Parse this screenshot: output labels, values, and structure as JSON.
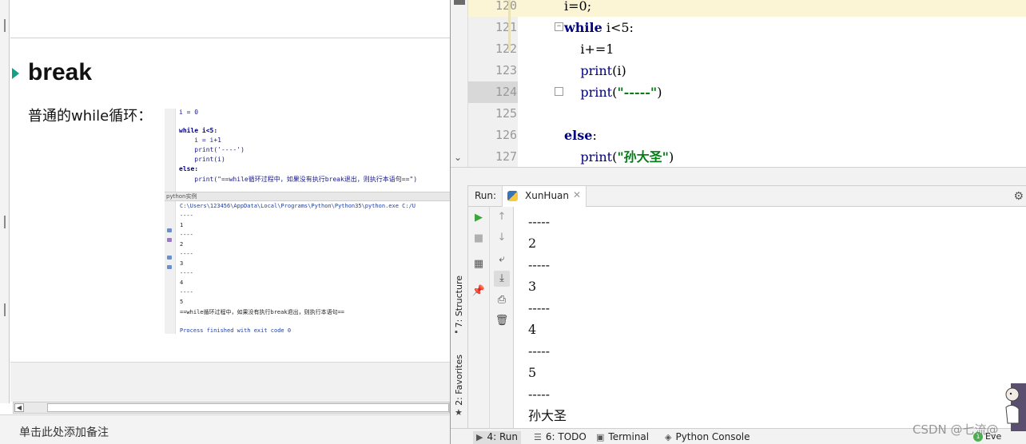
{
  "slide": {
    "heading": "break",
    "lead_text": "普通的while循环：",
    "screenshot": {
      "code_lines": [
        "i = 0",
        "",
        "while i<5:",
        "    i = i+1",
        "    print('----')",
        "    print(i)",
        "else:",
        "    print(\"==while循环过程中，如果没有执行break退出，则执行本语句==\")"
      ],
      "panel_title": "python实例",
      "output_lines": [
        "C:\\Users\\123456\\AppData\\Local\\Programs\\Python\\Python35\\python.exe C:/U",
        "----",
        "1",
        "----",
        "2",
        "----",
        "3",
        "----",
        "4",
        "----",
        "5",
        "==while循环过程中，如果没有执行break退出，则执行本语句==",
        "",
        "Process finished with exit code 0"
      ]
    },
    "notes_placeholder": "单击此处添加备注"
  },
  "ide": {
    "line_numbers": [
      "120",
      "121",
      "122",
      "123",
      "124",
      "125",
      "126",
      "127"
    ],
    "code": {
      "l120": "i=0;",
      "l121_kw": "while",
      "l121_rest": " i<5:",
      "l122": "    i+=1",
      "l123_fn": "    print",
      "l123_rest": "(i)",
      "l124_fn": "    print",
      "l124_open": "(",
      "l124_str": "\"-----\"",
      "l124_close": ")",
      "l126_kw": "else",
      "l126_rest": ":",
      "l127_fn": "    print",
      "l127_open": "(",
      "l127_str": "\"孙大圣\"",
      "l127_close": ")"
    },
    "run": {
      "label": "Run:",
      "tab_name": "XunHuan",
      "console_lines": [
        "-----",
        "2",
        "-----",
        "3",
        "-----",
        "4",
        "-----",
        "5",
        "-----",
        "孙大圣"
      ]
    },
    "side_tabs": {
      "structure": "7: Structure",
      "favorites": "2: Favorites"
    },
    "status_bar": {
      "run": "4: Run",
      "todo": "6: TODO",
      "terminal": "Terminal",
      "python_console": "Python Console",
      "event_log": "Eve"
    },
    "icons": {
      "run": "play-icon",
      "stop": "stop-icon",
      "settings": "gear-icon"
    },
    "colors": {
      "keyword": "#000080",
      "string": "#067d17",
      "current_line": "#fbf5d5",
      "run_green": "#3aa53a"
    }
  },
  "watermark": "CSDN @七流@"
}
